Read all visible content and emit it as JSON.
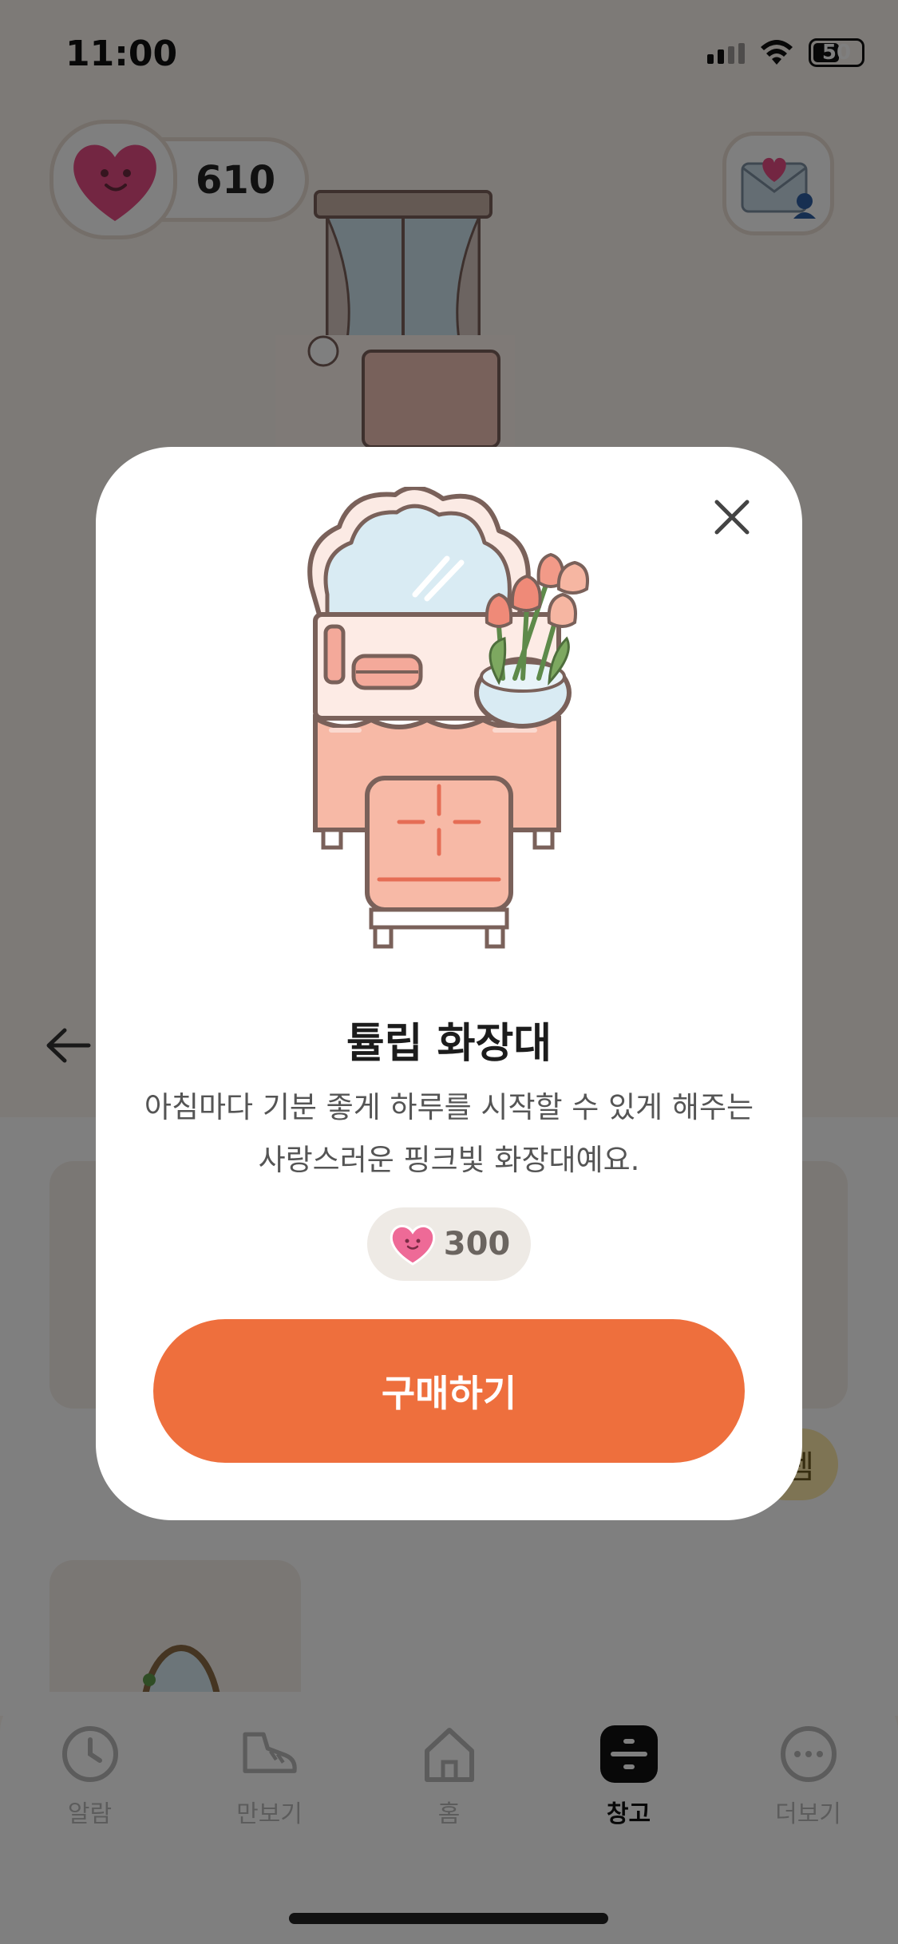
{
  "status_bar": {
    "time": "11:00",
    "battery": "50"
  },
  "room": {
    "heart_count": "610"
  },
  "tab_bar": {
    "tabs": [
      {
        "label": "알람",
        "icon": "clock-icon",
        "active": false
      },
      {
        "label": "만보기",
        "icon": "shoe-icon",
        "active": false
      },
      {
        "label": "홈",
        "icon": "home-icon",
        "active": false
      },
      {
        "label": "창고",
        "icon": "storage-icon",
        "active": true
      },
      {
        "label": "더보기",
        "icon": "more-icon",
        "active": false
      }
    ]
  },
  "background_chip": "템",
  "modal": {
    "item_name": "튤립 화장대",
    "description": "아침마다 기분 좋게 하루를 시작할 수 있게 해주는 사랑스러운 핑크빛 화장대예요.",
    "price": "300",
    "buy_label": "구매하기",
    "colors": {
      "accent": "#ee6f3d",
      "mirror": "#d9ebf3",
      "dresser_pink": "#f7b9a6",
      "outline": "#7a615a"
    }
  }
}
